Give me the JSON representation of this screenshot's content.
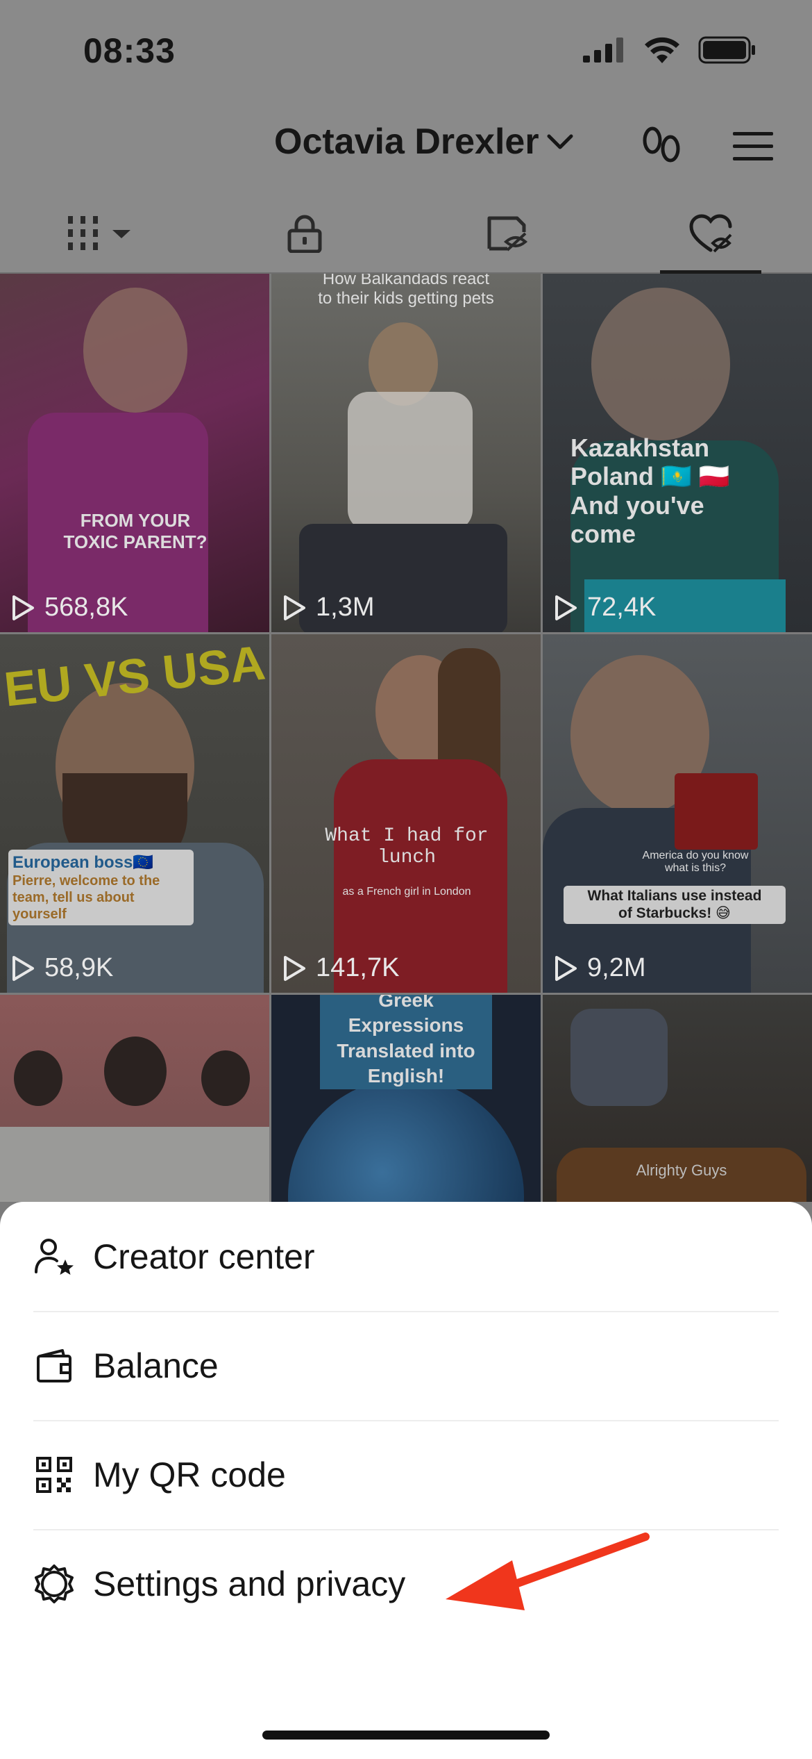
{
  "status_bar": {
    "time": "08:33",
    "icons": [
      "cellular-signal-icon",
      "wifi-icon",
      "battery-icon"
    ]
  },
  "header": {
    "profile_name": "Octavia Drexler",
    "icons": [
      "chevron-down-icon",
      "footprints-icon",
      "menu-icon"
    ]
  },
  "tabs": [
    {
      "icon": "grid-icon",
      "active": false
    },
    {
      "icon": "lock-icon",
      "active": false
    },
    {
      "icon": "hidden-photo-icon",
      "active": false
    },
    {
      "icon": "liked-icon",
      "active": true
    }
  ],
  "videos": [
    {
      "views": "568,8K",
      "caption": "FROM YOUR\nTOXIC PARENT?"
    },
    {
      "views": "1,3M",
      "caption": "How Balkandads react\nto their kids getting pets"
    },
    {
      "views": "72,4K",
      "caption": "Kazakhstan\nPoland 🇰🇿 🇵🇱\nAnd you've\ncome"
    },
    {
      "views": "58,9K",
      "caption": "EU VS USA",
      "subcaption": "European boss🇪🇺",
      "subcaption2": "Pierre, welcome to the team, tell us about yourself"
    },
    {
      "views": "141,7K",
      "caption": "What I had for\nlunch",
      "subcaption": "as a French girl in London"
    },
    {
      "views": "9,2M",
      "caption": "What Italians use instead\nof Starbucks! 😅",
      "subcaption": "America do you know\nwhat is this?"
    },
    {
      "views": "",
      "caption": ""
    },
    {
      "views": "",
      "caption": "Greek Expressions\nTranslated into\nEnglish!"
    },
    {
      "views": "",
      "caption": "Alrighty Guys"
    }
  ],
  "menu": {
    "items": [
      {
        "label": "Creator center",
        "icon": "creator-center-icon"
      },
      {
        "label": "Balance",
        "icon": "wallet-icon"
      },
      {
        "label": "My QR code",
        "icon": "qr-code-icon"
      },
      {
        "label": "Settings and privacy",
        "icon": "gear-icon"
      }
    ]
  },
  "annotation": {
    "color": "#f0361c",
    "icon": "red-arrow-icon"
  }
}
